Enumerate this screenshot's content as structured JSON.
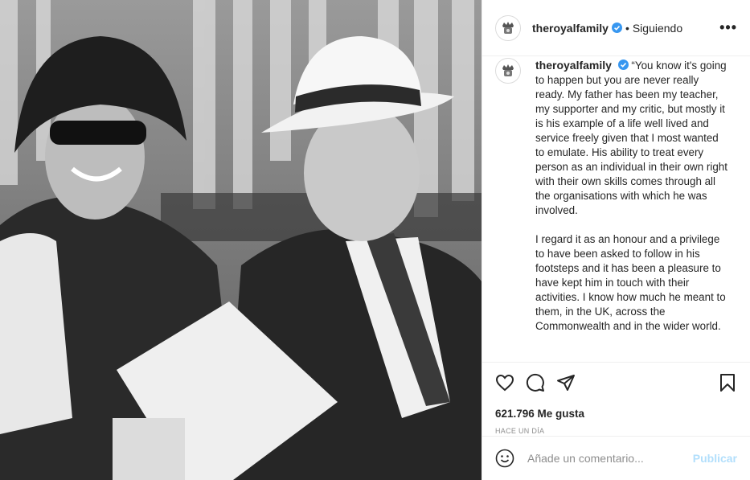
{
  "photo": {
    "alt": "Black and white photograph of two smiling people seated in a stadium"
  },
  "header": {
    "username": "theroyalfamily",
    "separator": "•",
    "follow_status": "Siguiendo",
    "more": "•••"
  },
  "caption": {
    "username": "theroyalfamily",
    "paragraphs": [
      "“You know it's going to happen but you are never really ready. My father has been my teacher, my supporter and my critic, but mostly it is his example of a life well lived and service freely given that I most wanted to emulate. His ability to treat every person as an individual in their own right with their own skills comes through all the organisations with which he was involved.",
      "I regard it as an honour and a privilege to have been asked to follow in his footsteps and it has been a pleasure to have kept him in touch with their activities. I know how much he meant to them, in the UK, across the Commonwealth and in the wider world."
    ]
  },
  "stats": {
    "likes": "621.796 Me gusta",
    "posted": "HACE UN DÍA"
  },
  "comment_box": {
    "placeholder": "Añade un comentario...",
    "publish": "Publicar"
  },
  "colors": {
    "verified": "#3897f0",
    "publish_disabled": "#b2dffc",
    "secondary_text": "#8e8e8e",
    "border": "#efefef"
  },
  "icons": [
    "crest-icon",
    "verified-badge-icon",
    "heart-icon",
    "comment-icon",
    "share-icon",
    "bookmark-icon",
    "emoji-icon"
  ]
}
